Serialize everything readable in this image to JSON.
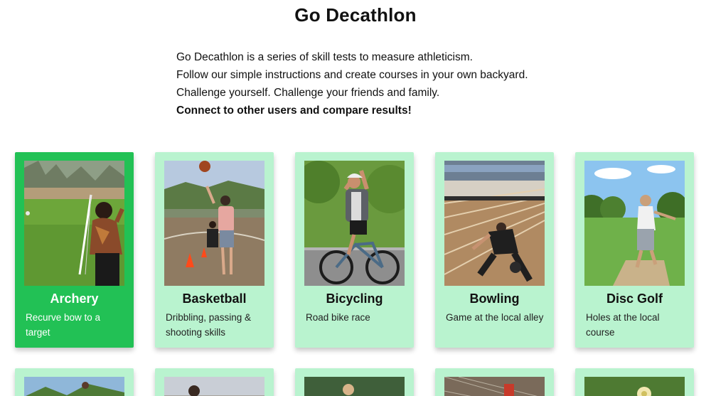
{
  "title": "Go Decathlon",
  "intro": {
    "line1": "Go Decathlon is a series of skill tests to measure athleticism.",
    "line2": "Follow our simple instructions and create courses in your own backyard.",
    "line3": "Challenge yourself. Challenge your friends and family.",
    "line4": "Connect to other users and compare results!"
  },
  "sports": [
    {
      "name": "Archery",
      "desc": "Recurve bow to a target"
    },
    {
      "name": "Basketball",
      "desc": "Dribbling, passing & shooting skills"
    },
    {
      "name": "Bicycling",
      "desc": "Road bike race"
    },
    {
      "name": "Bowling",
      "desc": "Game at the local alley"
    },
    {
      "name": "Disc Golf",
      "desc": "Holes at the local course"
    }
  ],
  "colors": {
    "card_background": "#b9f3cf",
    "card_selected": "#22c155"
  }
}
